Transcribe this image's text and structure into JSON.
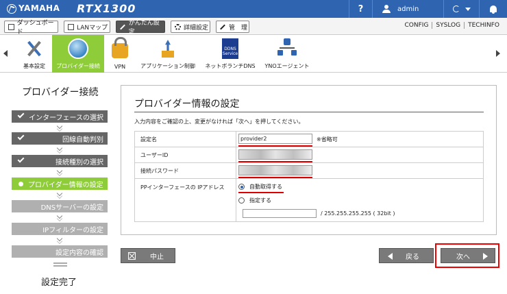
{
  "header": {
    "brand": "YAMAHA",
    "model": "RTX1300",
    "help": "?",
    "user": "admin"
  },
  "tabs": [
    {
      "label": "ダッシュボード"
    },
    {
      "label": "LANマップ"
    },
    {
      "label": "かんたん設定"
    },
    {
      "label": "詳細設定"
    },
    {
      "label": "管　理"
    }
  ],
  "right_links": [
    "CONFIG",
    "SYSLOG",
    "TECHINFO"
  ],
  "menu": [
    {
      "label": "基本設定",
      "icon": "tools-icon"
    },
    {
      "label": "プロバイダー接続",
      "icon": "globe-icon"
    },
    {
      "label": "VPN",
      "icon": "lock-icon"
    },
    {
      "label": "アプリケーション制御",
      "icon": "app-control-icon"
    },
    {
      "label": "ネットボランチDNS",
      "icon": "ddns-icon"
    },
    {
      "label": "YNOエージェント",
      "icon": "network-icon"
    }
  ],
  "ddns_badge": "DDNS Service",
  "steps": {
    "title": "プロバイダー接続",
    "items": [
      {
        "label": "インターフェースの選択",
        "state": "done"
      },
      {
        "label": "回線自動判別",
        "state": "done"
      },
      {
        "label": "接続種別の選択",
        "state": "done"
      },
      {
        "label": "プロバイダー情報の設定",
        "state": "current"
      },
      {
        "label": "DNSサーバーの設定",
        "state": "todo"
      },
      {
        "label": "IPフィルターの設定",
        "state": "todo"
      },
      {
        "label": "設定内容の確認",
        "state": "todo"
      }
    ],
    "done_label": "設定完了"
  },
  "panel": {
    "title": "プロバイダー情報の設定",
    "description": "入力内容をご確認の上、変更がなければ「次へ」を押してください。",
    "fields": {
      "name_label": "設定名",
      "name_value": "provider2",
      "name_note": "※省略可",
      "userid_label": "ユーザーID",
      "password_label": "接続パスワード",
      "ip_label": "PPインターフェースの IPアドレス",
      "ip_auto": "自動取得する",
      "ip_manual": "指定する",
      "ip_mask": "/ 255.255.255.255 ( 32bit )"
    }
  },
  "buttons": {
    "cancel": "中止",
    "back": "戻る",
    "next": "次へ"
  },
  "colors": {
    "header": "#2f64b0",
    "accent_green": "#8fcc3a",
    "highlight_red": "#dd0000"
  }
}
